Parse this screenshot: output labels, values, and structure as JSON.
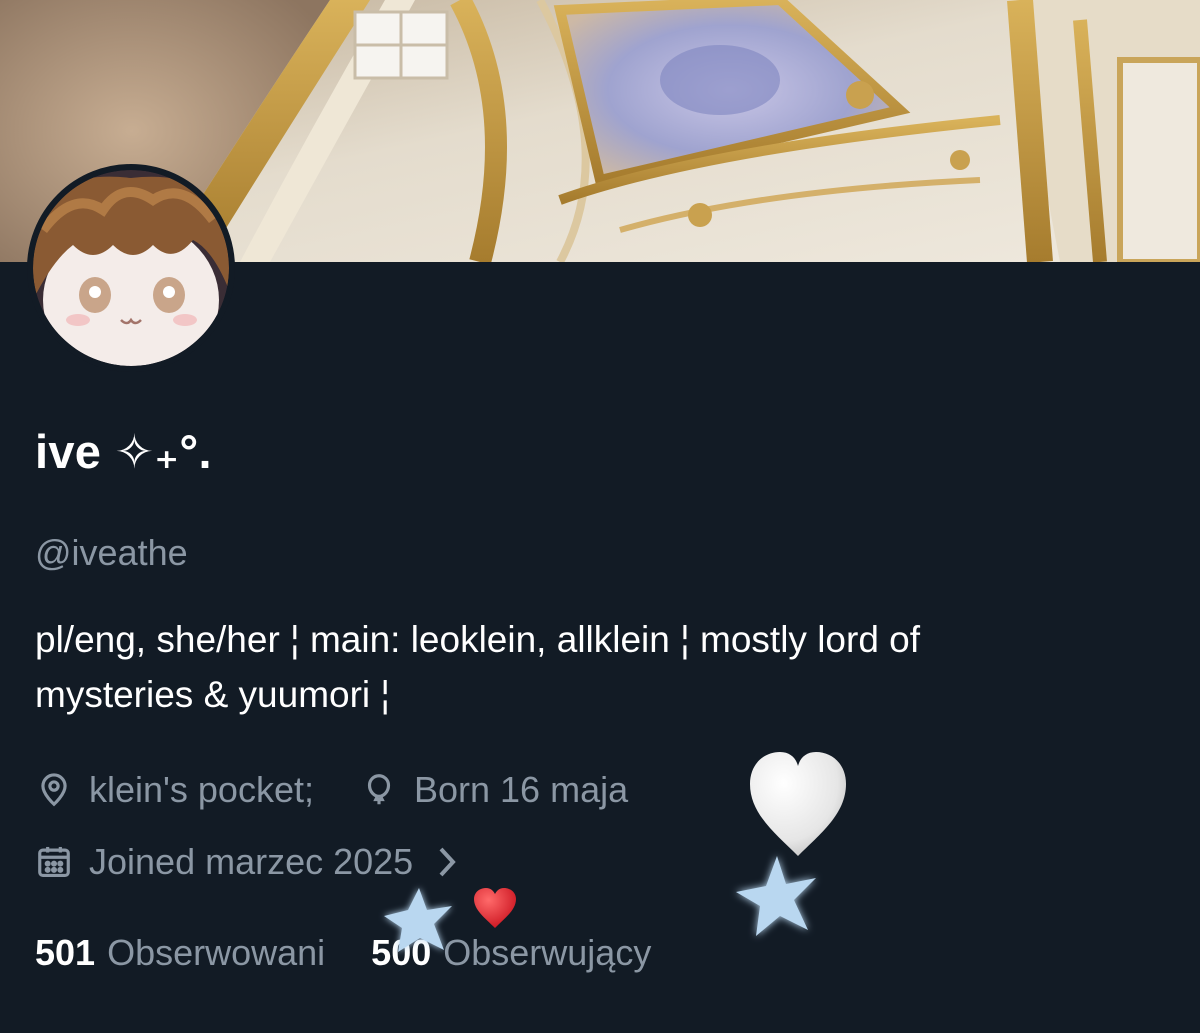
{
  "profile": {
    "display_name": "ive ✧₊°.",
    "handle": "@iveathe",
    "bio_line1": "pl/eng, she/her ¦ main: leoklein, allklein ¦ mostly lord of",
    "bio_line2": "mysteries & yuumori ¦",
    "location": "klein's pocket;",
    "birthday": "Born 16 maja",
    "joined": "Joined marzec 2025",
    "following_count": "501",
    "following_label": "Obserwowani",
    "followers_count": "500",
    "followers_label": "Obserwujący"
  },
  "icons": {
    "location": "location-pin-icon",
    "birthday": "balloon-icon",
    "joined": "calendar-icon",
    "more": "chevron-right-icon"
  },
  "stickers": [
    "white-heart",
    "blue-star-left",
    "blue-star-right",
    "red-heart"
  ],
  "colors": {
    "background": "#121b25",
    "primary_text": "#ffffff",
    "secondary_text": "#8b97a4",
    "star_blue": "#b9d7f0"
  }
}
